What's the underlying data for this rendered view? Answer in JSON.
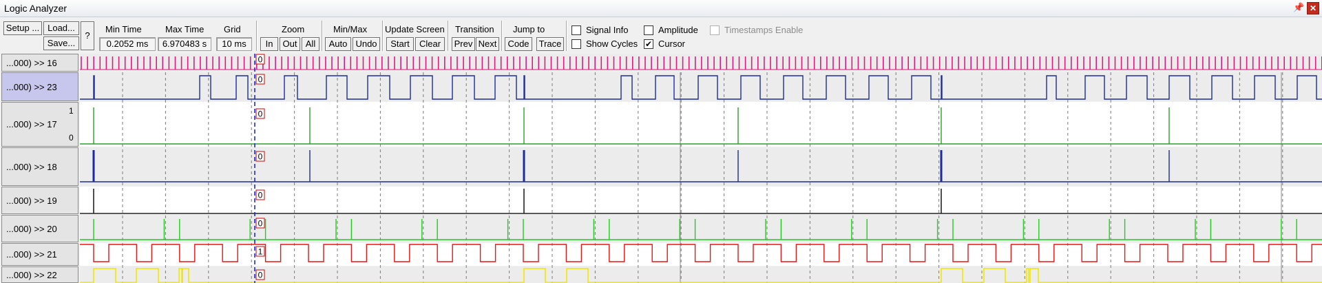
{
  "window": {
    "title": "Logic Analyzer",
    "pin_icon": "pin-icon",
    "close_icon": "close-icon"
  },
  "toolbar": {
    "setup_label": "Setup ...",
    "load_label": "Load...",
    "save_label": "Save...",
    "help_label": "?",
    "min_time_label": "Min Time",
    "min_time_value": "0.2052 ms",
    "max_time_label": "Max Time",
    "max_time_value": "6.970483 s",
    "grid_label": "Grid",
    "grid_value": "10 ms",
    "zoom_label": "Zoom",
    "zoom_in": "In",
    "zoom_out": "Out",
    "zoom_all": "All",
    "minmax_label": "Min/Max",
    "minmax_auto": "Auto",
    "minmax_undo": "Undo",
    "update_label": "Update Screen",
    "update_start": "Start",
    "update_clear": "Clear",
    "transition_label": "Transition",
    "transition_prev": "Prev",
    "transition_next": "Next",
    "jump_label": "Jump to",
    "jump_code": "Code",
    "jump_trace": "Trace",
    "signal_info": "Signal Info",
    "show_cycles": "Show Cycles",
    "amplitude": "Amplitude",
    "cursor": "Cursor",
    "timestamps": "Timestamps Enable"
  },
  "checkboxes": {
    "signal_info": false,
    "show_cycles": false,
    "amplitude": false,
    "cursor": true,
    "timestamps": false
  },
  "signals": [
    {
      "name": "...000) >> 16",
      "cursor_value": "0",
      "color": "#e0197d"
    },
    {
      "name": "...000) >> 23",
      "cursor_value": "0",
      "color": "#1d2a9c"
    },
    {
      "name": "...000) >> 17",
      "cursor_value": "0",
      "color": "#2aa02a",
      "y_max": "1",
      "y_min": "0"
    },
    {
      "name": "...000) >> 18",
      "cursor_value": "0",
      "color": "#1d2a9c"
    },
    {
      "name": "...000) >> 19",
      "cursor_value": "0",
      "color": "#222222"
    },
    {
      "name": "...000) >> 20",
      "cursor_value": "0",
      "color": "#22cc22"
    },
    {
      "name": "...000) >> 21",
      "cursor_value": "1",
      "color": "#ee1111"
    },
    {
      "name": "...000) >> 22",
      "cursor_value": "0",
      "color": "#f2e600"
    }
  ],
  "colors": {
    "cursor": "#1a2ad6",
    "value_box_border": "#d00000"
  }
}
